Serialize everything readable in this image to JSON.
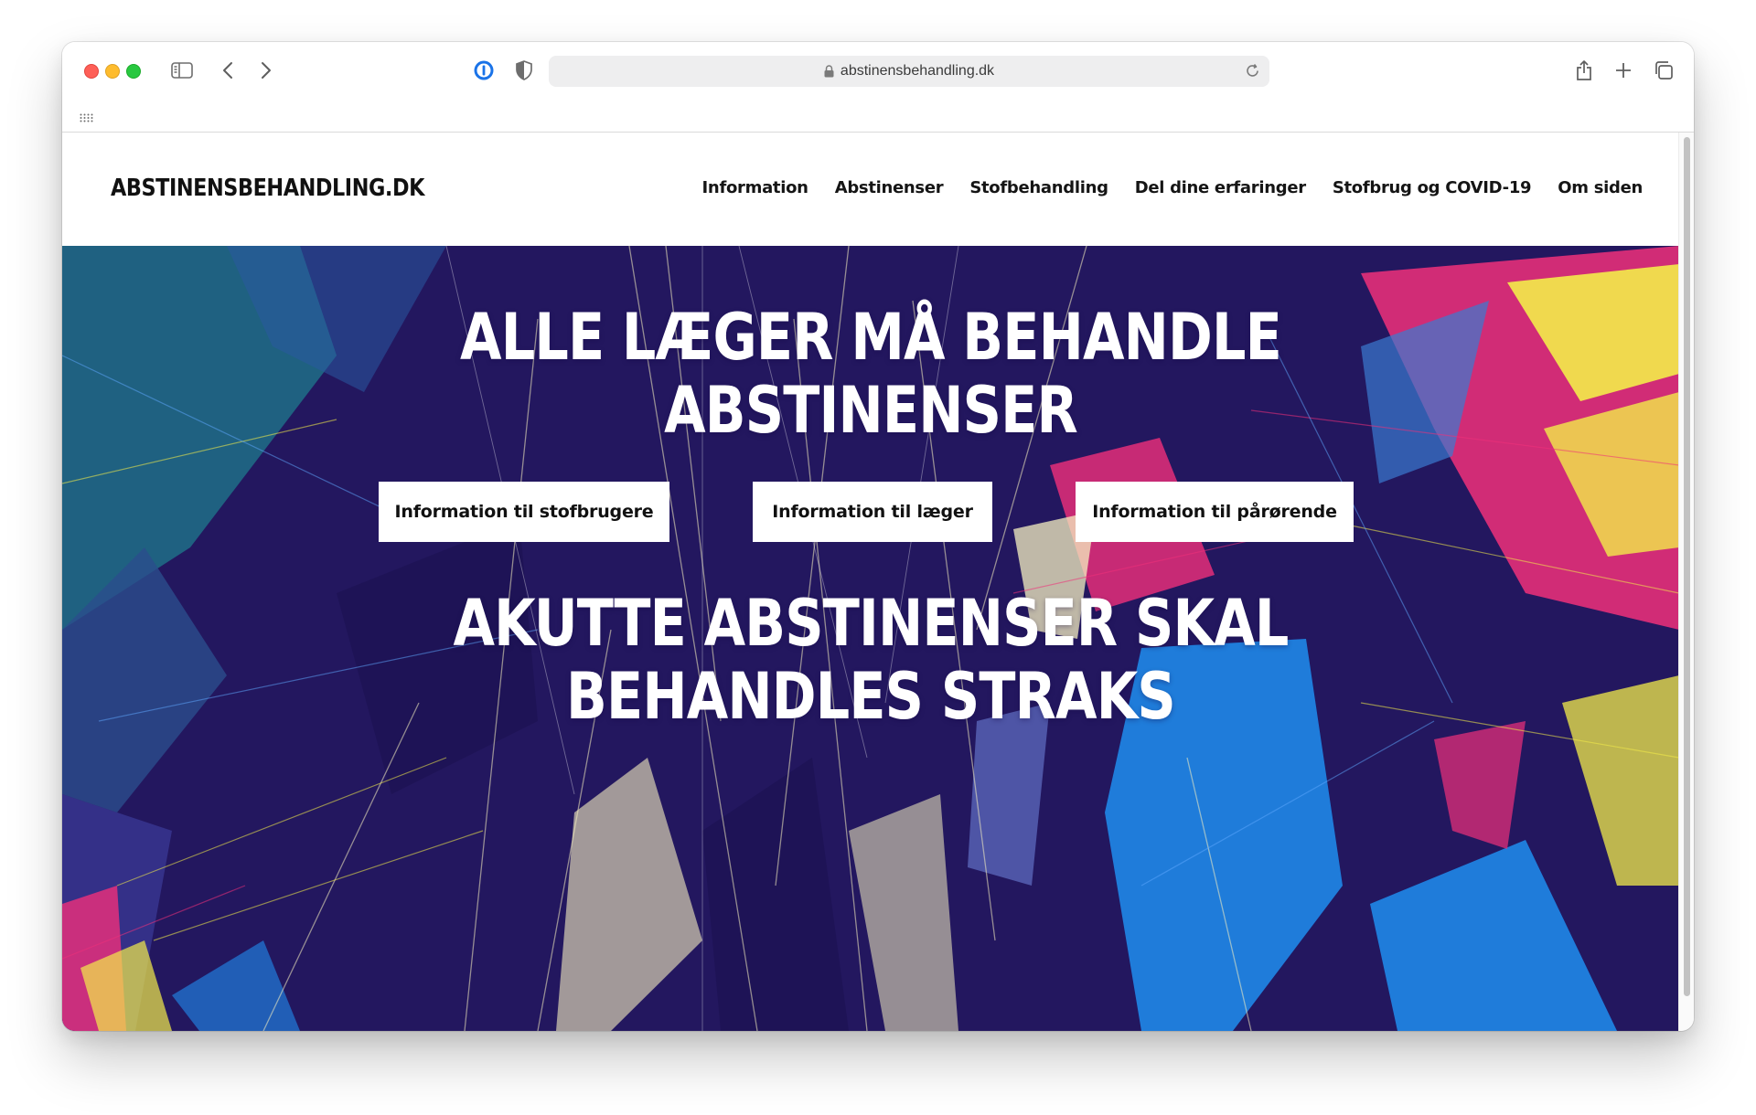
{
  "browser": {
    "url": "abstinensbehandling.dk"
  },
  "site": {
    "logo": "ABSTINENSBEHANDLING.DK",
    "nav": [
      "Information",
      "Abstinenser",
      "Stofbehandling",
      "Del dine erfaringer",
      "Stofbrug og COVID-19",
      "Om siden"
    ]
  },
  "hero": {
    "headline_1_line_1": "ALLE LÆGER MÅ BEHANDLE",
    "headline_1_line_2": "ABSTINENSER",
    "buttons": [
      "Information til stofbrugere",
      "Information til læger",
      "Information til pårørende"
    ],
    "headline_2_line_1": "AKUTTE ABSTINENSER SKAL",
    "headline_2_line_2": "BEHANDLES STRAKS"
  },
  "colors": {
    "hero_background": "#23175f",
    "accent_pink": "#f0307a",
    "accent_yellow": "#f3ec4a",
    "accent_blue": "#1f8ef0",
    "accent_teal": "#1f6f87",
    "accent_cream": "#f6f0c0"
  }
}
